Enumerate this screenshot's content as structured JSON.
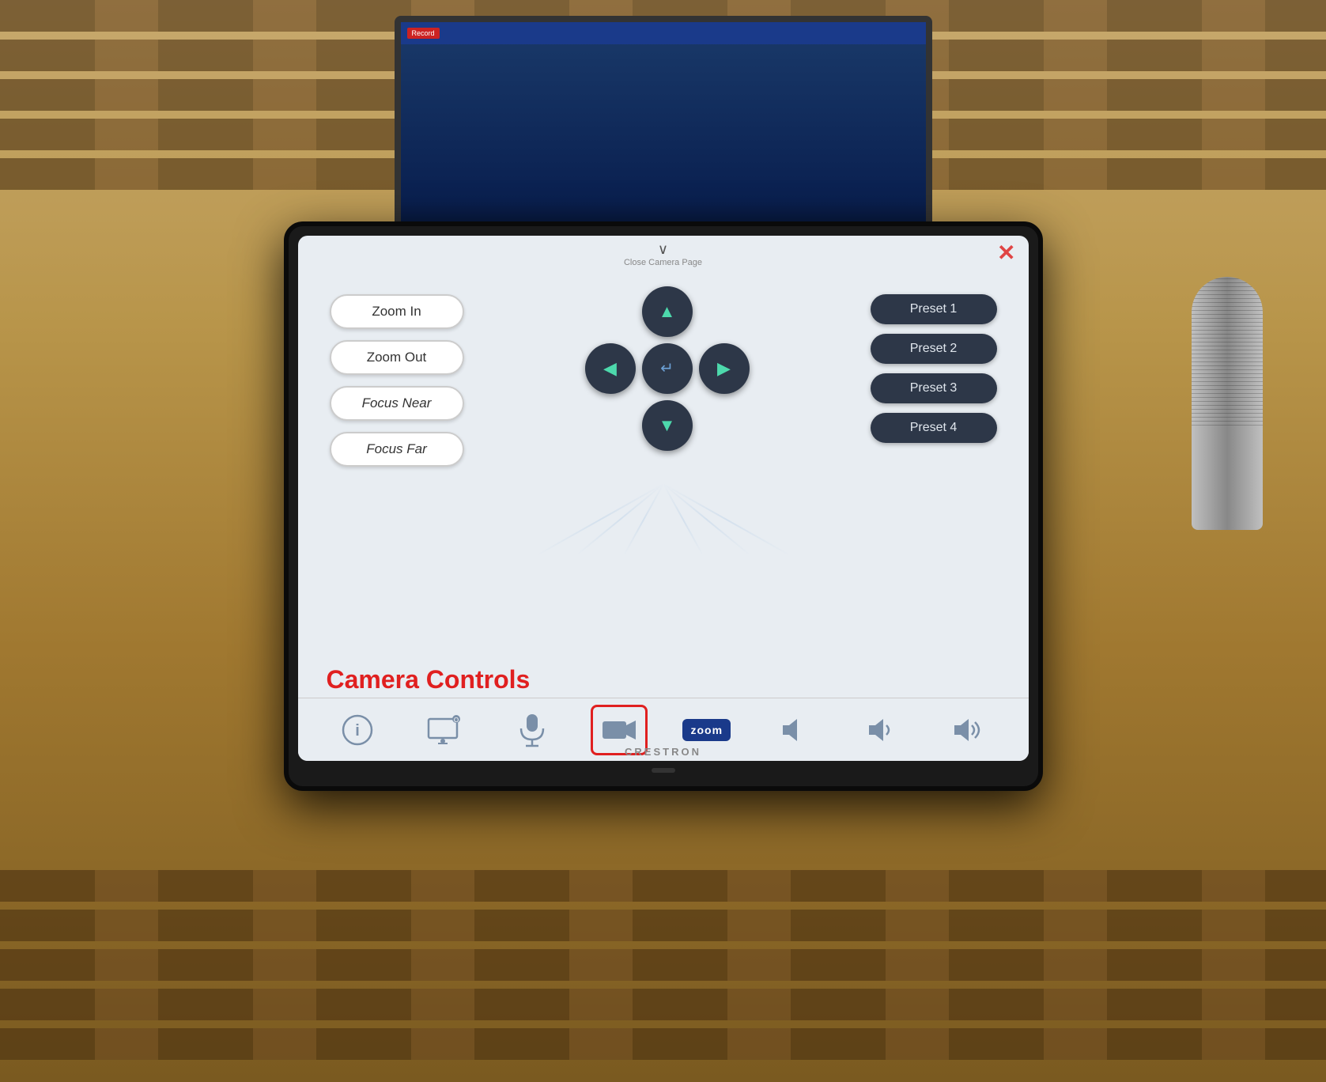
{
  "room": {
    "background_description": "Lecture hall with rows of benches"
  },
  "monitor": {
    "record_label": "Record"
  },
  "close_header": {
    "chevron": "∨",
    "label": "Close Camera Page",
    "close_btn": "✕"
  },
  "left_controls": {
    "zoom_in": "Zoom In",
    "zoom_out": "Zoom Out",
    "focus_near": "Focus Near",
    "focus_far": "Focus Far"
  },
  "dpad": {
    "up_icon": "▲",
    "down_icon": "▼",
    "left_icon": "◀",
    "right_icon": "▶",
    "center_icon": "↵"
  },
  "presets": {
    "items": [
      "Preset 1",
      "Preset 2",
      "Preset 3",
      "Preset 4"
    ]
  },
  "camera_controls_label": "Camera Controls",
  "bottom_nav": {
    "items": [
      {
        "id": "info",
        "icon": "ℹ",
        "label": "info"
      },
      {
        "id": "display",
        "icon": "⊟",
        "label": "display"
      },
      {
        "id": "mic",
        "icon": "🎤",
        "label": "microphone"
      },
      {
        "id": "camera",
        "icon": "📹",
        "label": "camera",
        "active": true
      },
      {
        "id": "zoom",
        "label": "zoom",
        "is_zoom": true
      },
      {
        "id": "vol_muted",
        "icon": "🔇",
        "label": "volume-muted"
      },
      {
        "id": "vol_low",
        "icon": "🔉",
        "label": "volume-low"
      },
      {
        "id": "vol_high",
        "icon": "🔊",
        "label": "volume-high"
      }
    ],
    "zoom_text": "zoom"
  },
  "crestron_label": "CRESTRON"
}
